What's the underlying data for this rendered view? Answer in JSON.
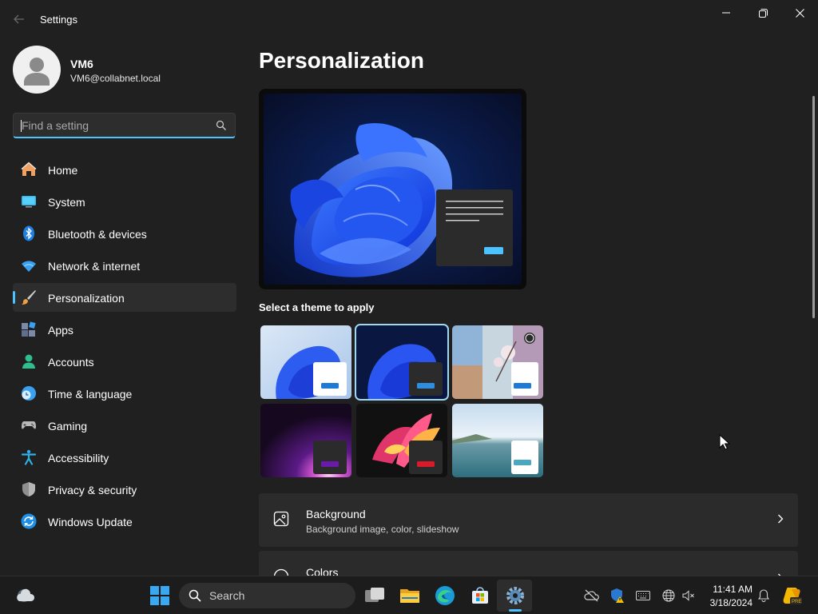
{
  "window": {
    "title": "Settings",
    "back_icon": "back-arrow-icon",
    "controls": [
      "minimize-icon",
      "restore-icon",
      "close-icon"
    ]
  },
  "profile": {
    "name": "VM6",
    "email": "VM6@collabnet.local",
    "avatar_icon": "person-icon"
  },
  "search": {
    "placeholder": "Find a setting",
    "value": "",
    "icon": "search-icon"
  },
  "sidebar": {
    "items": [
      {
        "label": "Home",
        "icon": "home-icon",
        "active": false
      },
      {
        "label": "System",
        "icon": "monitor-icon",
        "active": false
      },
      {
        "label": "Bluetooth & devices",
        "icon": "bluetooth-icon",
        "active": false
      },
      {
        "label": "Network & internet",
        "icon": "wifi-icon",
        "active": false
      },
      {
        "label": "Personalization",
        "icon": "paintbrush-icon",
        "active": true
      },
      {
        "label": "Apps",
        "icon": "apps-icon",
        "active": false
      },
      {
        "label": "Accounts",
        "icon": "account-icon",
        "active": false
      },
      {
        "label": "Time & language",
        "icon": "clock-globe-icon",
        "active": false
      },
      {
        "label": "Gaming",
        "icon": "gamepad-icon",
        "active": false
      },
      {
        "label": "Accessibility",
        "icon": "accessibility-icon",
        "active": false
      },
      {
        "label": "Privacy & security",
        "icon": "shield-icon",
        "active": false
      },
      {
        "label": "Windows Update",
        "icon": "update-icon",
        "active": false
      }
    ]
  },
  "main": {
    "title": "Personalization",
    "themes_heading": "Select a theme to apply",
    "themes": [
      {
        "name": "windows-light",
        "selected": false
      },
      {
        "name": "windows-dark",
        "selected": true
      },
      {
        "name": "spotlight",
        "selected": false
      },
      {
        "name": "glow",
        "selected": false
      },
      {
        "name": "captured-motion",
        "selected": false
      },
      {
        "name": "flow",
        "selected": false
      }
    ],
    "cards": [
      {
        "title": "Background",
        "subtitle": "Background image, color, slideshow",
        "icon": "picture-icon"
      },
      {
        "title": "Colors",
        "subtitle": "",
        "icon": "palette-icon"
      }
    ]
  },
  "taskbar": {
    "search_label": "Search",
    "time": "11:41 AM",
    "date": "3/18/2024",
    "accent": "#4cc2ff"
  },
  "colors": {
    "accent": "#4cc2ff",
    "background": "#202020",
    "card": "#2b2b2b"
  }
}
